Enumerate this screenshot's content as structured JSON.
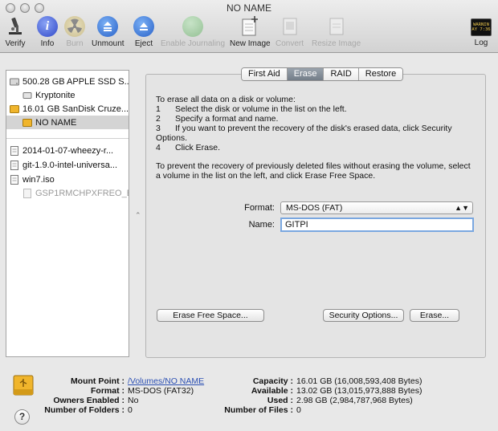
{
  "window": {
    "title": "NO NAME"
  },
  "toolbar": {
    "items": [
      {
        "label": "Verify"
      },
      {
        "label": "Info"
      },
      {
        "label": "Burn"
      },
      {
        "label": "Unmount"
      },
      {
        "label": "Eject"
      },
      {
        "label": "Enable Journaling"
      },
      {
        "label": "New Image"
      },
      {
        "label": "Convert"
      },
      {
        "label": "Resize Image"
      },
      {
        "label": "Log"
      }
    ],
    "log_icon_text": "WARNIN\nAY 7:36"
  },
  "sidebar": {
    "items": [
      {
        "label": "500.28 GB APPLE SSD S..."
      },
      {
        "label": "Kryptonite"
      },
      {
        "label": "16.01 GB SanDisk Cruze..."
      },
      {
        "label": "NO NAME"
      },
      {
        "label": "2014-01-07-wheezy-r..."
      },
      {
        "label": "git-1.9.0-intel-universa..."
      },
      {
        "label": "win7.iso"
      },
      {
        "label": "GSP1RMCHPXFREO_E..."
      }
    ]
  },
  "tabs": [
    {
      "label": "First Aid"
    },
    {
      "label": "Erase"
    },
    {
      "label": "RAID"
    },
    {
      "label": "Restore"
    }
  ],
  "erase": {
    "intro": "To erase all data on a disk or volume:",
    "steps": [
      {
        "num": "1",
        "text": "Select the disk or volume in the list on the left."
      },
      {
        "num": "2",
        "text": "Specify a format and name."
      },
      {
        "num": "3",
        "text": "If you want to prevent the recovery of the disk's erased data, click Security"
      },
      {
        "num": "4",
        "text": "Click Erase."
      }
    ],
    "step3_cont": "Options.",
    "free_space_text": "To prevent the recovery of previously deleted files without erasing the volume, select a volume in the list on the left, and click Erase Free Space.",
    "format_label": "Format:",
    "format_value": "MS-DOS (FAT)",
    "name_label": "Name:",
    "name_value": "GITPI",
    "erase_free_space_button": "Erase Free Space...",
    "security_options_button": "Security Options...",
    "erase_button": "Erase..."
  },
  "info": {
    "mount_point_label": "Mount Point :",
    "mount_point_value": "/Volumes/NO NAME",
    "format_label": "Format :",
    "format_value": "MS-DOS (FAT32)",
    "owners_label": "Owners Enabled :",
    "owners_value": "No",
    "folders_label": "Number of Folders :",
    "folders_value": "0",
    "capacity_label": "Capacity :",
    "capacity_value": "16.01 GB (16,008,593,408 Bytes)",
    "available_label": "Available :",
    "available_value": "13.02 GB (13,015,973,888 Bytes)",
    "used_label": "Used :",
    "used_value": "2.98 GB (2,984,787,968 Bytes)",
    "files_label": "Number of Files :",
    "files_value": "0"
  },
  "help_label": "?",
  "colors": {
    "selection": "#d4d4d4",
    "focus_ring": "#7aa7e0",
    "active_tab": "#7b8590"
  }
}
